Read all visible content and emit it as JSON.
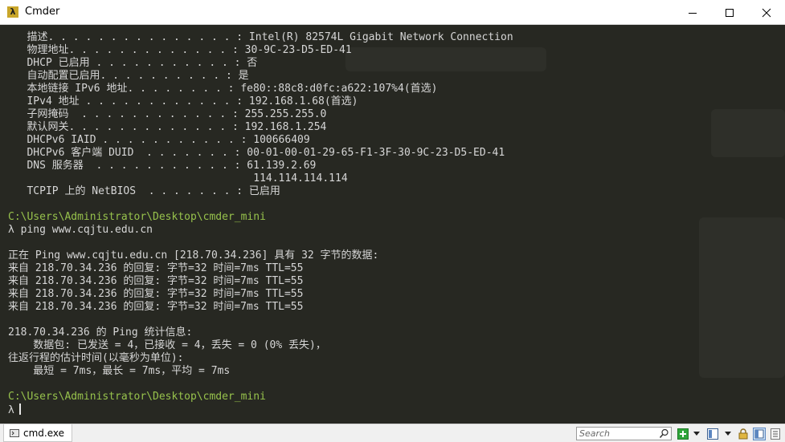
{
  "window": {
    "title": "Cmder",
    "app_icon_glyph": "λ"
  },
  "colors": {
    "console_bg": "#272822",
    "text": "#d6d6d6",
    "prompt_path": "#97c24c",
    "titlebar": "#ffffff"
  },
  "console": {
    "lines": [
      "   描述. . . . . . . . . . . . . . . : Intel(R) 82574L Gigabit Network Connection",
      "   物理地址. . . . . . . . . . . . . : 30-9C-23-D5-ED-41",
      "   DHCP 已启用 . . . . . . . . . . . : 否",
      "   自动配置已启用. . . . . . . . . . : 是",
      "   本地链接 IPv6 地址. . . . . . . . : fe80::88c8:d0fc:a622:107%4(首选)",
      "   IPv4 地址 . . . . . . . . . . . . : 192.168.1.68(首选)",
      "   子网掩码  . . . . . . . . . . . . : 255.255.255.0",
      "   默认网关. . . . . . . . . . . . . : 192.168.1.254",
      "   DHCPv6 IAID . . . . . . . . . . . : 100666409",
      "   DHCPv6 客户端 DUID  . . . . . . . : 00-01-00-01-29-65-F1-3F-30-9C-23-D5-ED-41",
      "   DNS 服务器  . . . . . . . . . . . : 61.139.2.69",
      "                                       114.114.114.114",
      "   TCPIP 上的 NetBIOS  . . . . . . . : 已启用",
      "",
      "C:\\Users\\Administrator\\Desktop\\cmder_mini",
      "λ ping www.cqjtu.edu.cn",
      "",
      "正在 Ping www.cqjtu.edu.cn [218.70.34.236] 具有 32 字节的数据:",
      "来自 218.70.34.236 的回复: 字节=32 时间=7ms TTL=55",
      "来自 218.70.34.236 的回复: 字节=32 时间=7ms TTL=55",
      "来自 218.70.34.236 的回复: 字节=32 时间=7ms TTL=55",
      "来自 218.70.34.236 的回复: 字节=32 时间=7ms TTL=55",
      "",
      "218.70.34.236 的 Ping 统计信息:",
      "    数据包: 已发送 = 4，已接收 = 4，丢失 = 0 (0% 丢失)，",
      "往返行程的估计时间(以毫秒为单位):",
      "    最短 = 7ms，最长 = 7ms，平均 = 7ms",
      "",
      "C:\\Users\\Administrator\\Desktop\\cmder_mini",
      "λ"
    ],
    "prompt_line_indexes": [
      14,
      28
    ],
    "cursor_line_index": 29
  },
  "statusbar": {
    "tab_label": "cmd.exe",
    "search_placeholder": "Search",
    "icons": [
      "search-icon",
      "new-console-plus-icon",
      "dropdown-arrow-icon",
      "split-layout-icon",
      "lock-icon",
      "view-toggle-icon",
      "menu-icon"
    ]
  }
}
